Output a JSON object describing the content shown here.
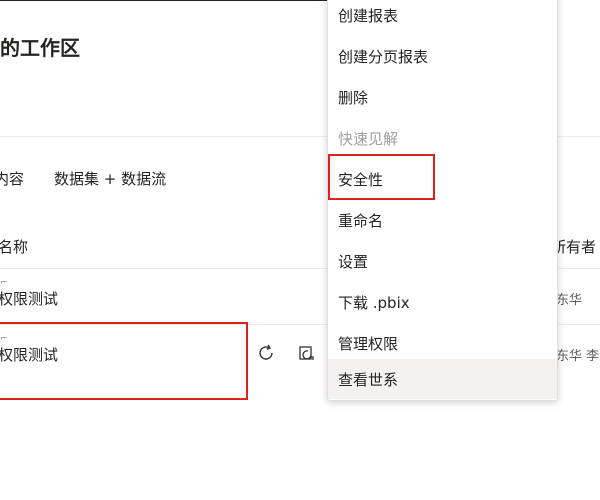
{
  "workspace": {
    "title": "的工作区"
  },
  "tabs": [
    {
      "label": "内容"
    },
    {
      "label": "数据集 + 数据流"
    }
  ],
  "table": {
    "headers": {
      "name": "名称",
      "owner": "所有者"
    },
    "rows": [
      {
        "name": "权限测试",
        "owner": "东华"
      },
      {
        "name": "权限测试",
        "owner": "东华 李"
      }
    ]
  },
  "context_menu": {
    "items": [
      {
        "label": "创建报表",
        "state": "normal"
      },
      {
        "label": "创建分页报表",
        "state": "normal"
      },
      {
        "label": "删除",
        "state": "normal"
      },
      {
        "label": "快速见解",
        "state": "disabled"
      },
      {
        "label": "安全性",
        "state": "highlighted"
      },
      {
        "label": "重命名",
        "state": "normal"
      },
      {
        "label": "设置",
        "state": "normal"
      },
      {
        "label": "下载 .pbix",
        "state": "normal"
      },
      {
        "label": "管理权限",
        "state": "normal"
      },
      {
        "label": "查看世系",
        "state": "hover"
      }
    ]
  },
  "icons": {
    "refresh": "refresh-icon",
    "schedule": "schedule-refresh-icon"
  },
  "colors": {
    "annotation_red": "#e0201b",
    "disabled_text": "#a19f9d"
  }
}
